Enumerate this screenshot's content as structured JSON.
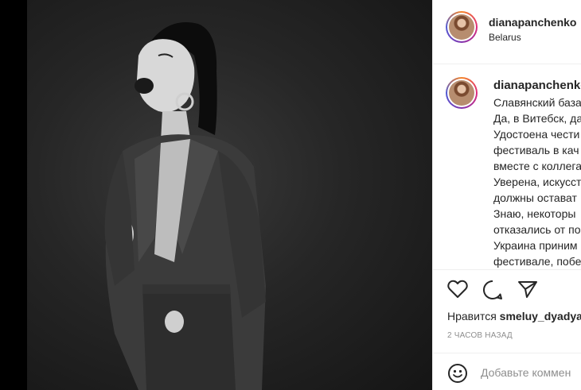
{
  "post": {
    "header": {
      "username": "dianapanchenko",
      "location": "Belarus"
    },
    "caption": {
      "username": "dianapanchenko",
      "lines": [
        "Славянский база",
        "Да, в Витебск, да",
        "Удостоена чести",
        "фестиваль в кач",
        "вместе с коллега",
        "Уверена, искусст",
        "должны остават",
        "Знаю, некоторы",
        "отказались от по",
        "Украина приним",
        "фестивале, побе"
      ]
    },
    "actions": {
      "like_icon": "heart-icon",
      "comment_icon": "comment-icon",
      "share_icon": "share-icon"
    },
    "likes": {
      "prefix": "Нравится",
      "user": "smeluy_dyadya"
    },
    "timestamp": "2 ЧАСОВ НАЗАД",
    "comment": {
      "emoji_icon": "emoji-icon",
      "placeholder": "Добавьте коммен"
    }
  }
}
